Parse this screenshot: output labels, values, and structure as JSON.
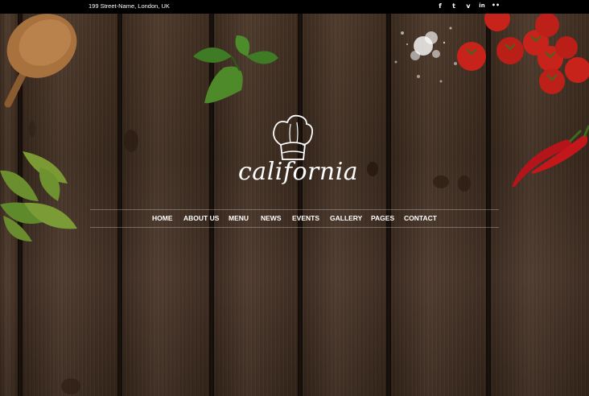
{
  "topbar": {
    "address": "199 Street-Name, London, UK",
    "social": [
      {
        "icon": "facebook-icon",
        "glyph": "f"
      },
      {
        "icon": "twitter-icon",
        "glyph": "t"
      },
      {
        "icon": "vimeo-icon",
        "glyph": "v"
      },
      {
        "icon": "linkedin-icon",
        "glyph": "in"
      },
      {
        "icon": "flickr-icon",
        "glyph": "••"
      }
    ]
  },
  "logo": {
    "text": "california"
  },
  "nav": {
    "items": [
      {
        "label": "HOME"
      },
      {
        "label": "ABOUT US"
      },
      {
        "label": "MENU"
      },
      {
        "label": "NEWS"
      },
      {
        "label": "EVENTS"
      },
      {
        "label": "GALLERY"
      },
      {
        "label": "PAGES"
      },
      {
        "label": "CONTACT"
      }
    ]
  },
  "colors": {
    "wood": "#4a3627",
    "topbar": "#000000",
    "text": "#ffffff",
    "tomato": "#c8231a",
    "chili": "#b5141a",
    "leaf": "#4f8a2a"
  }
}
